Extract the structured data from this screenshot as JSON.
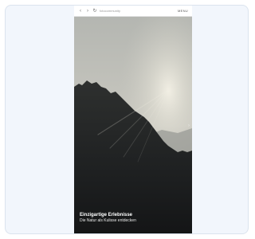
{
  "browser": {
    "back_icon": "chevron-left-icon",
    "forward_icon": "chevron-right-icon",
    "refresh_icon": "refresh-icon",
    "address": "fotocommunity",
    "menu_label": "MENU"
  },
  "hero": {
    "title": "Einzigartige Erlebnisse",
    "subtitle": "Die Natur als Kulisse entdecken",
    "next_icon": "chevron-right-icon"
  },
  "colors": {
    "card_background": "#f2f6fc",
    "card_border": "#dbe3ee",
    "sky_top": "#b9bbb6",
    "sky_glow": "#e8e6dc",
    "forest": "#191b1d"
  }
}
